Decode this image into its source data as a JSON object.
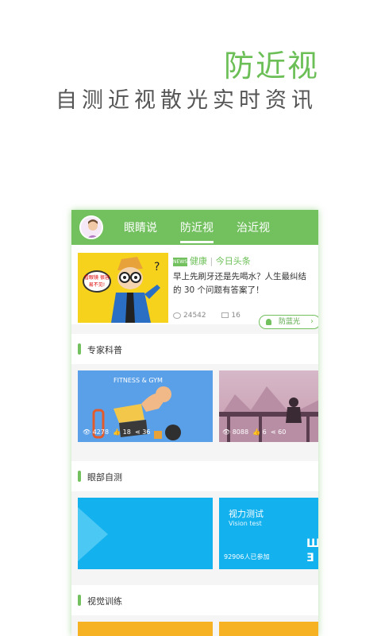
{
  "headline": "防近视",
  "subline": "自测近视散光实时资讯",
  "tabs": [
    {
      "label": "眼睛说"
    },
    {
      "label": "防近视"
    },
    {
      "label": "治近视"
    }
  ],
  "news": {
    "bubble_text": "看眼镜 很容易不见!",
    "logo_text": "NEWS",
    "source": "健康",
    "source_sub": "今日头条",
    "title": "早上先刷牙还是先喝水？人生最纠结的 30 个问题有答案了！",
    "views": "24542",
    "comments": "16",
    "bluelight_label": "防蓝光"
  },
  "sections": [
    {
      "title": "专家科普"
    },
    {
      "title": "眼部自测"
    },
    {
      "title": "视觉训练"
    }
  ],
  "cards": {
    "fitness": {
      "label": "FITNESS & GYM",
      "views": "4278",
      "likes": "18",
      "shares": "36"
    },
    "scenic": {
      "views": "8088",
      "likes": "6",
      "shares": "60"
    },
    "vision": {
      "title": "视力测试",
      "subtitle": "Vision test",
      "participants": "92906人已参加"
    }
  },
  "colors": {
    "accent": "#72c05e",
    "headline": "#6cbf57",
    "blue": "#13b1ee",
    "orange": "#f7b224"
  }
}
